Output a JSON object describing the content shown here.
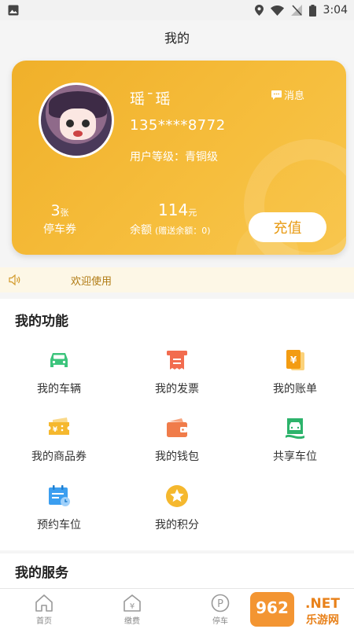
{
  "status": {
    "time": "3:04"
  },
  "title": "我的",
  "profile": {
    "name": "瑶¯瑶",
    "messages_label": "消息",
    "phone": "135****8772",
    "level": "用户等级：青铜级",
    "coupons_count": "3",
    "coupons_unit": "张",
    "coupons_label": "停车券",
    "balance_value": "114",
    "balance_unit": "元",
    "balance_label": "余额",
    "gift_balance": "(赠送余额：0)",
    "recharge_label": "充值"
  },
  "notice": {
    "text": "欢迎使用"
  },
  "functions": {
    "title": "我的功能",
    "items": [
      {
        "label": "我的车辆",
        "icon": "car-icon",
        "color": "#3cc47c"
      },
      {
        "label": "我的发票",
        "icon": "invoice-icon",
        "color": "#f26c4f"
      },
      {
        "label": "我的账单",
        "icon": "bill-icon",
        "color": "#f39c12"
      },
      {
        "label": "我的商品券",
        "icon": "voucher-icon",
        "color": "#f5b82e"
      },
      {
        "label": "我的钱包",
        "icon": "wallet-icon",
        "color": "#f07c4a"
      },
      {
        "label": "共享车位",
        "icon": "shared-parking-icon",
        "color": "#2db36b"
      },
      {
        "label": "预约车位",
        "icon": "reserve-icon",
        "color": "#3b9ef0"
      },
      {
        "label": "我的积分",
        "icon": "points-icon",
        "color": "#f5b82e"
      }
    ]
  },
  "services": {
    "title": "我的服务"
  },
  "tabs": [
    {
      "label": "首页",
      "icon": "home-icon"
    },
    {
      "label": "缴费",
      "icon": "payment-icon"
    },
    {
      "label": "停车",
      "icon": "parking-icon"
    }
  ],
  "watermark": {
    "top": "962",
    "bottom": "乐游网",
    "net": ".NET"
  }
}
